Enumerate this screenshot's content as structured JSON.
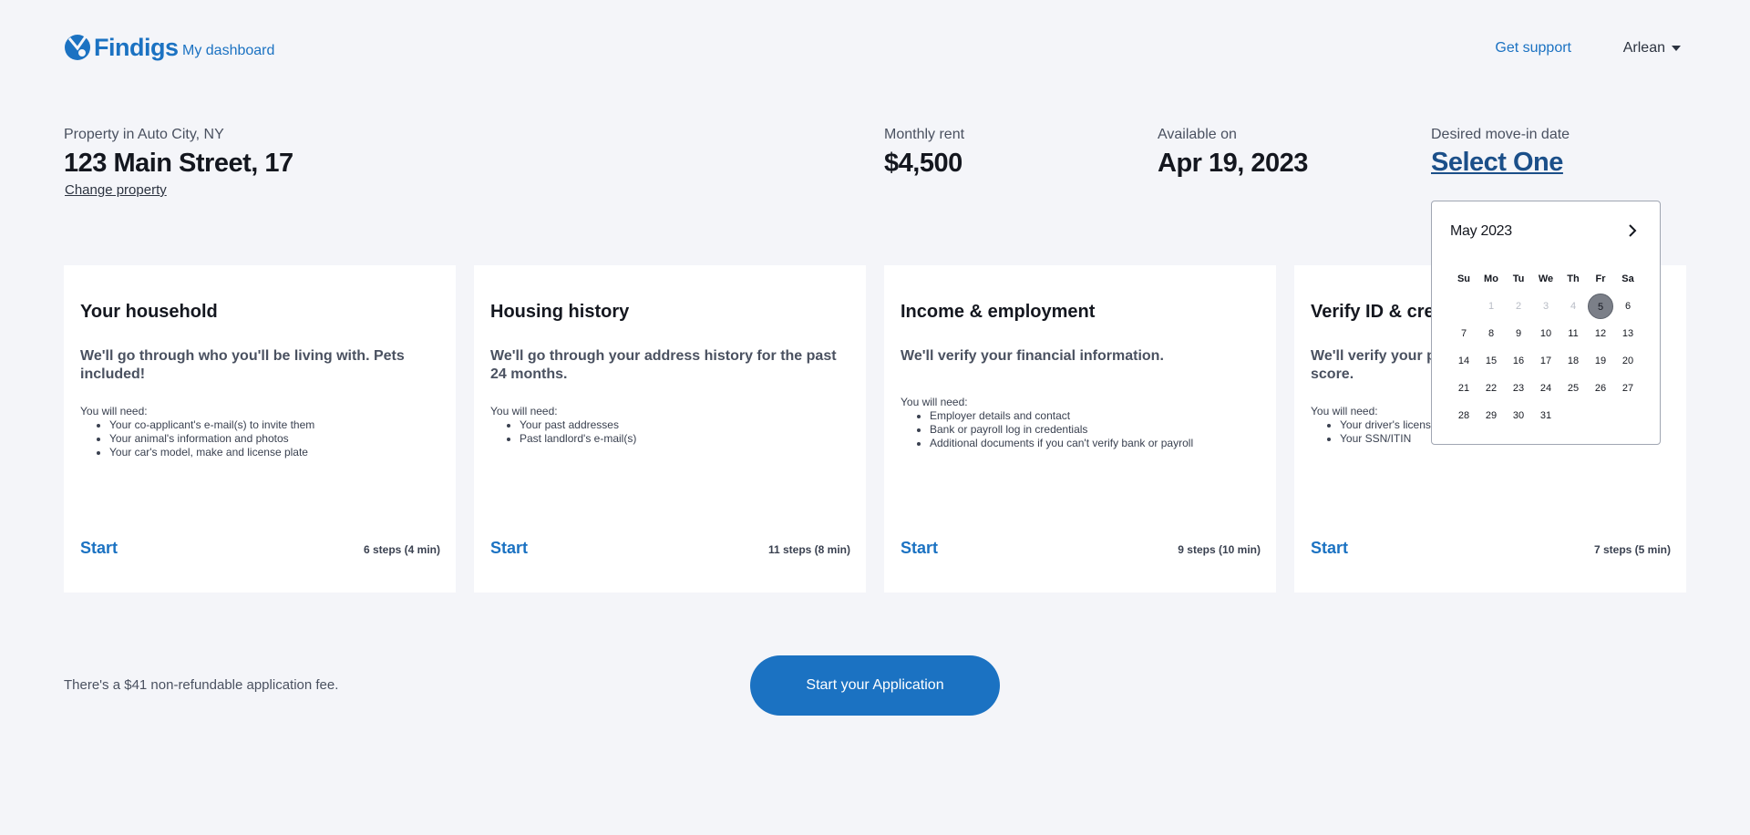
{
  "header": {
    "brand": "Findigs",
    "dashboard_link": "My dashboard",
    "support_link": "Get support",
    "user_name": "Arlean"
  },
  "property": {
    "location_label": "Property in Auto City, NY",
    "address": "123 Main Street, 17",
    "change_link": "Change property"
  },
  "rent": {
    "label": "Monthly rent",
    "value": "$4,500"
  },
  "availability": {
    "label": "Available on",
    "value": "Apr 19, 2023"
  },
  "move_in": {
    "label": "Desired move-in date",
    "value": "Select One"
  },
  "calendar": {
    "month_label": "May 2023",
    "weekdays": [
      "Su",
      "Mo",
      "Tu",
      "We",
      "Th",
      "Fr",
      "Sa"
    ],
    "weeks": [
      [
        "",
        "1",
        "2",
        "3",
        "4",
        "5",
        "6"
      ],
      [
        "7",
        "8",
        "9",
        "10",
        "11",
        "12",
        "13"
      ],
      [
        "14",
        "15",
        "16",
        "17",
        "18",
        "19",
        "20"
      ],
      [
        "21",
        "22",
        "23",
        "24",
        "25",
        "26",
        "27"
      ],
      [
        "28",
        "29",
        "30",
        "31",
        "",
        "",
        ""
      ]
    ],
    "disabled_days": [
      "1",
      "2",
      "3",
      "4"
    ],
    "selected_day": "5"
  },
  "cards": [
    {
      "title": "Your household",
      "description": "We'll go through who you'll be living with. Pets included!",
      "need_label": "You will need:",
      "needs": [
        "Your co-applicant's e-mail(s) to invite them",
        "Your animal's information and photos",
        "Your car's model, make and license plate"
      ],
      "start_label": "Start",
      "steps": "6 steps (4 min)"
    },
    {
      "title": "Housing history",
      "description": "We'll go through your address history for the past 24 months.",
      "need_label": "You will need:",
      "needs": [
        "Your past addresses",
        "Past landlord's e-mail(s)"
      ],
      "start_label": "Start",
      "steps": "11 steps (8 min)"
    },
    {
      "title": "Income & employment",
      "description": "We'll verify your financial information.",
      "need_label": "You will need:",
      "needs": [
        "Employer details and contact",
        "Bank or payroll log in credentials",
        "Additional documents if you can't verify bank or payroll"
      ],
      "start_label": "Start",
      "steps": "9 steps (10 min)"
    },
    {
      "title": "Verify ID & credit",
      "description": "We'll verify your personal identity and credit score.",
      "need_label": "You will need:",
      "needs": [
        "Your driver's license or passport",
        "Your SSN/ITIN"
      ],
      "start_label": "Start",
      "steps": "7 steps (5 min)"
    }
  ],
  "footer": {
    "fee_text": "There's a $41 non-refundable application fee.",
    "cta_label": "Start your Application"
  },
  "colors": {
    "accent": "#1b72c2",
    "background": "#f4f5f9",
    "card": "#ffffff",
    "selected_day": "#7b7f88"
  }
}
